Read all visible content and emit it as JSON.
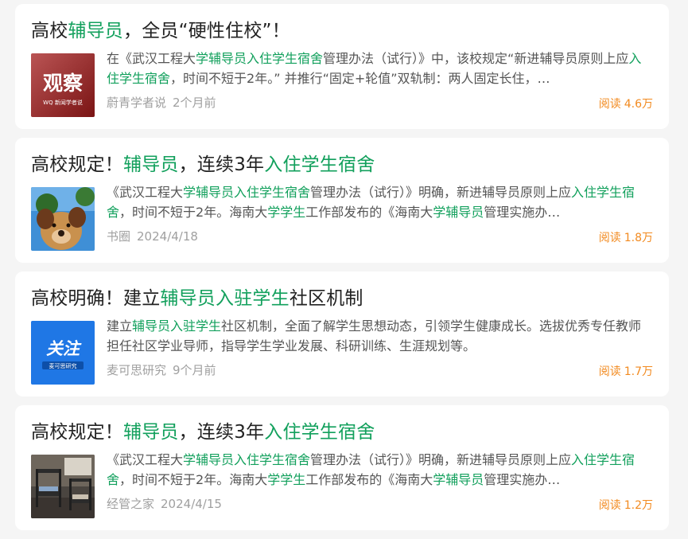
{
  "colors": {
    "highlight": "#12a05c",
    "reads": "#f28a1f",
    "card_bg": "#ffffff",
    "page_bg": "#f5f5f5"
  },
  "results": [
    {
      "title": [
        {
          "t": "高校",
          "hl": false
        },
        {
          "t": "辅导员",
          "hl": true
        },
        {
          "t": "，全员“硬性住校”！",
          "hl": false
        }
      ],
      "snippet": [
        {
          "t": "在《武汉工程大",
          "hl": false
        },
        {
          "t": "学辅导员入住学生宿舍",
          "hl": true
        },
        {
          "t": "管理办法（试行）》中，该校规定“新进辅导员原则上应",
          "hl": false
        },
        {
          "t": "入住学生宿舍",
          "hl": true
        },
        {
          "t": "，时间不短于2年。” 并推行“固定+轮值”双轨制：两人固定长住，…",
          "hl": false
        }
      ],
      "thumb": {
        "kind": "observe",
        "label": "观察",
        "sub": "WQ 新闻学者说"
      },
      "source": "蔚青学者说",
      "date": "2个月前",
      "reads_label": "阅读",
      "reads_value": "4.6万"
    },
    {
      "title": [
        {
          "t": "高校规定！",
          "hl": false
        },
        {
          "t": "辅导员",
          "hl": true
        },
        {
          "t": "，连续3年",
          "hl": false
        },
        {
          "t": "入住学生宿舍",
          "hl": true
        }
      ],
      "snippet": [
        {
          "t": "《武汉工程大",
          "hl": false
        },
        {
          "t": "学辅导员入住学生宿舍",
          "hl": true
        },
        {
          "t": "管理办法（试行）》明确，新进辅导员原则上应",
          "hl": false
        },
        {
          "t": "入住学生宿舍",
          "hl": true
        },
        {
          "t": "，时间不短于2年。海南大",
          "hl": false
        },
        {
          "t": "学学生",
          "hl": true
        },
        {
          "t": "工作部发布的《海南大",
          "hl": false
        },
        {
          "t": "学辅导员",
          "hl": true
        },
        {
          "t": "管理实施办…",
          "hl": false
        }
      ],
      "thumb": {
        "kind": "dog"
      },
      "source": "书圈",
      "date": "2024/4/18",
      "reads_label": "阅读",
      "reads_value": "1.8万"
    },
    {
      "title": [
        {
          "t": "高校明确！建立",
          "hl": false
        },
        {
          "t": "辅导员入驻学生",
          "hl": true
        },
        {
          "t": "社区机制",
          "hl": false
        }
      ],
      "snippet": [
        {
          "t": "建立",
          "hl": false
        },
        {
          "t": "辅导员入驻学生",
          "hl": true
        },
        {
          "t": "社区机制，全面了解学生思想动态，引领学生健康成长。选拔优秀专任教师担任社区学业导师，指导学生学业发展、科研训练、生涯规划等。",
          "hl": false
        }
      ],
      "thumb": {
        "kind": "focus",
        "label": "关注",
        "sub": "麦可思研究"
      },
      "source": "麦可思研究",
      "date": "9个月前",
      "reads_label": "阅读",
      "reads_value": "1.7万"
    },
    {
      "title": [
        {
          "t": "高校规定！",
          "hl": false
        },
        {
          "t": "辅导员",
          "hl": true
        },
        {
          "t": "，连续3年",
          "hl": false
        },
        {
          "t": "入住学生宿舍",
          "hl": true
        }
      ],
      "snippet": [
        {
          "t": "《武汉工程大",
          "hl": false
        },
        {
          "t": "学辅导员入住学生宿舍",
          "hl": true
        },
        {
          "t": "管理办法（试行）》明确，新进辅导员原则上应",
          "hl": false
        },
        {
          "t": "入住学生宿舍",
          "hl": true
        },
        {
          "t": "，时间不短于2年。海南大",
          "hl": false
        },
        {
          "t": "学学生",
          "hl": true
        },
        {
          "t": "工作部发布的《海南大",
          "hl": false
        },
        {
          "t": "学辅导员",
          "hl": true
        },
        {
          "t": "管理实施办…",
          "hl": false
        }
      ],
      "thumb": {
        "kind": "dorm"
      },
      "source": "经管之家",
      "date": "2024/4/15",
      "reads_label": "阅读",
      "reads_value": "1.2万"
    }
  ]
}
